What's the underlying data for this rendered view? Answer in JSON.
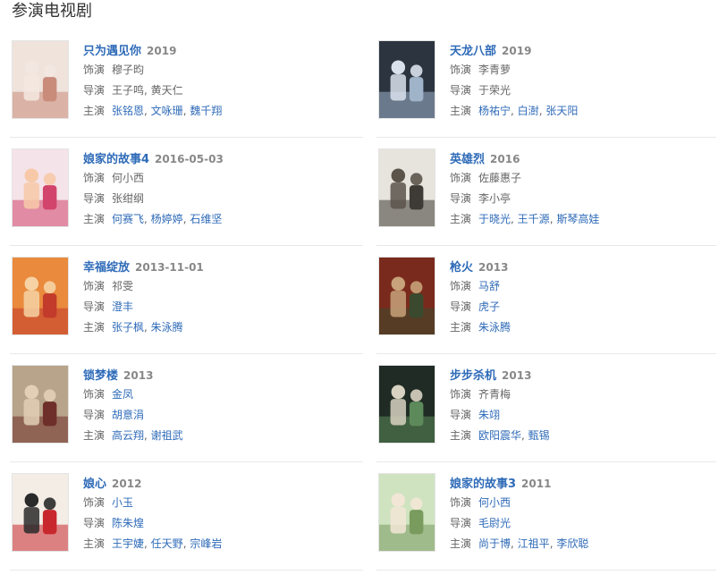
{
  "section": {
    "title": "参演电视剧"
  },
  "labels": {
    "role": "饰演",
    "director": "导演",
    "cast": "主演",
    "separator": ", "
  },
  "colors": {
    "link": "#2f6bb8",
    "muted": "#666666",
    "year": "#888888",
    "divider": "#e8e8e8"
  },
  "shows": [
    {
      "title": "只为遇见你",
      "date": "2019",
      "role": "穆子昀",
      "role_link": false,
      "directors": [
        "王子鸣",
        "黄天仁"
      ],
      "director_link": false,
      "cast": [
        "张铭恩",
        "文咏珊",
        "魏千翔"
      ],
      "poster": {
        "bg": "#efe3dc",
        "accent": "#c98b7a",
        "figure": "#f3e7e1"
      }
    },
    {
      "title": "天龙八部",
      "date": "2019",
      "role": "李青萝",
      "role_link": false,
      "directors": [
        "于荣光"
      ],
      "director_link": false,
      "cast": [
        "杨祐宁",
        "白澍",
        "张天阳"
      ],
      "poster": {
        "bg": "#2c3440",
        "accent": "#9fb3c9",
        "figure": "#d9e2ec"
      }
    },
    {
      "title": "娘家的故事4",
      "date": "2016-05-03",
      "role": "何小西",
      "role_link": false,
      "directors": [
        "张绀纲"
      ],
      "director_link": false,
      "cast": [
        "何赛飞",
        "杨婷婷",
        "石维坚"
      ],
      "poster": {
        "bg": "#f4e3e8",
        "accent": "#d2446b",
        "figure": "#f7c9a8"
      }
    },
    {
      "title": "英雄烈",
      "date": "2016",
      "role": "佐藤惠子",
      "role_link": false,
      "directors": [
        "李小亭"
      ],
      "director_link": false,
      "cast": [
        "于晓光",
        "王千源",
        "斯琴高娃"
      ],
      "poster": {
        "bg": "#e7e4de",
        "accent": "#3e3a35",
        "figure": "#5b544b"
      }
    },
    {
      "title": "幸福绽放",
      "date": "2013-11-01",
      "role": "祁雯",
      "role_link": false,
      "directors": [
        "澄丰"
      ],
      "director_link": true,
      "cast": [
        "张子枫",
        "朱泳腾"
      ],
      "poster": {
        "bg": "#e98a3d",
        "accent": "#c23b2b",
        "figure": "#f6d2a4"
      }
    },
    {
      "title": "枪火",
      "date": "2013",
      "role": "马舒",
      "role_link": true,
      "directors": [
        "虎子"
      ],
      "director_link": true,
      "cast": [
        "朱泳腾"
      ],
      "poster": {
        "bg": "#7a2a1c",
        "accent": "#3b4a2e",
        "figure": "#c7a27a"
      }
    },
    {
      "title": "锁梦楼",
      "date": "2013",
      "role": "金凤",
      "role_link": true,
      "directors": [
        "胡意涓"
      ],
      "director_link": true,
      "cast": [
        "高云翔",
        "谢祖武"
      ],
      "poster": {
        "bg": "#b8a48a",
        "accent": "#6e2f2a",
        "figure": "#e2cfb5"
      }
    },
    {
      "title": "步步杀机",
      "date": "2013",
      "role": "齐青梅",
      "role_link": false,
      "directors": [
        "朱翊"
      ],
      "director_link": true,
      "cast": [
        "欧阳震华",
        "甄锡"
      ],
      "poster": {
        "bg": "#1f2b24",
        "accent": "#5d8a5a",
        "figure": "#d8d2c2"
      }
    },
    {
      "title": "娘心",
      "date": "2012",
      "role": "小玉",
      "role_link": true,
      "directors": [
        "陈朱煌"
      ],
      "director_link": true,
      "cast": [
        "王宇婕",
        "任天野",
        "宗峰岩"
      ],
      "poster": {
        "bg": "#f3ede6",
        "accent": "#c8282d",
        "figure": "#2a2a2a"
      }
    },
    {
      "title": "娘家的故事3",
      "date": "2011",
      "role": "何小西",
      "role_link": true,
      "directors": [
        "毛尉光"
      ],
      "director_link": true,
      "cast": [
        "尚于博",
        "江祖平",
        "李欣聪"
      ],
      "poster": {
        "bg": "#cfe3c0",
        "accent": "#7a9b5e",
        "figure": "#f2e6d6"
      }
    }
  ]
}
